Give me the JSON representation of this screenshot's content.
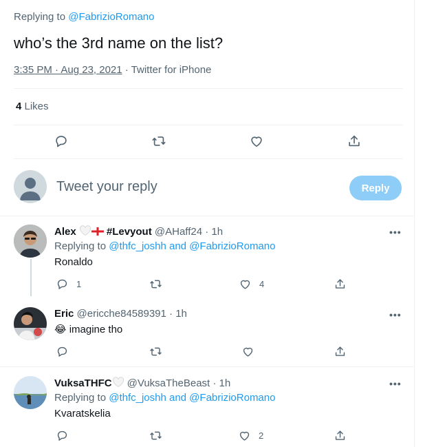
{
  "main_tweet": {
    "replying_prefix": "Replying to",
    "replying_handle": "@FabrizioRomano",
    "text": "who’s the 3rd name on the list?",
    "time": "3:35 PM · Aug 23, 2021",
    "source": " · Twitter for iPhone",
    "likes_count": "4",
    "likes_label": " Likes"
  },
  "compose": {
    "placeholder": "Tweet your reply",
    "reply_label": "Reply"
  },
  "replies": [
    {
      "display_name": "Alex",
      "name_suffix": "#Levyout",
      "handle": "@AHaff24",
      "time": " · 1h",
      "replying_prefix": "Replying to",
      "replying_to": "@thfc_joshh and @FabrizioRomano",
      "text": "Ronaldo",
      "reply_count": "1",
      "retweet_count": "",
      "like_count": "4"
    },
    {
      "display_name": "Eric",
      "handle": "@ericche84589391",
      "time": " · 1h",
      "emoji": "😂",
      "text": "imagine tho",
      "reply_count": "",
      "retweet_count": "",
      "like_count": ""
    },
    {
      "display_name": "VuksaTHFC",
      "handle": "@VuksaTheBeast",
      "time": " · 1h",
      "replying_prefix": "Replying to",
      "replying_to": "@thfc_joshh and @FabrizioRomano",
      "text": "Kvaratskelia",
      "reply_count": "",
      "retweet_count": "",
      "like_count": "2"
    }
  ],
  "more_label": "•••",
  "colors": {
    "accent": "#1d9bf0",
    "reply_button_disabled": "#8ecdf8",
    "muted": "#536471"
  },
  "icons": [
    "reply-icon",
    "retweet-icon",
    "like-icon",
    "share-icon",
    "more-icon",
    "white-heart-icon",
    "england-flag-icon"
  ]
}
